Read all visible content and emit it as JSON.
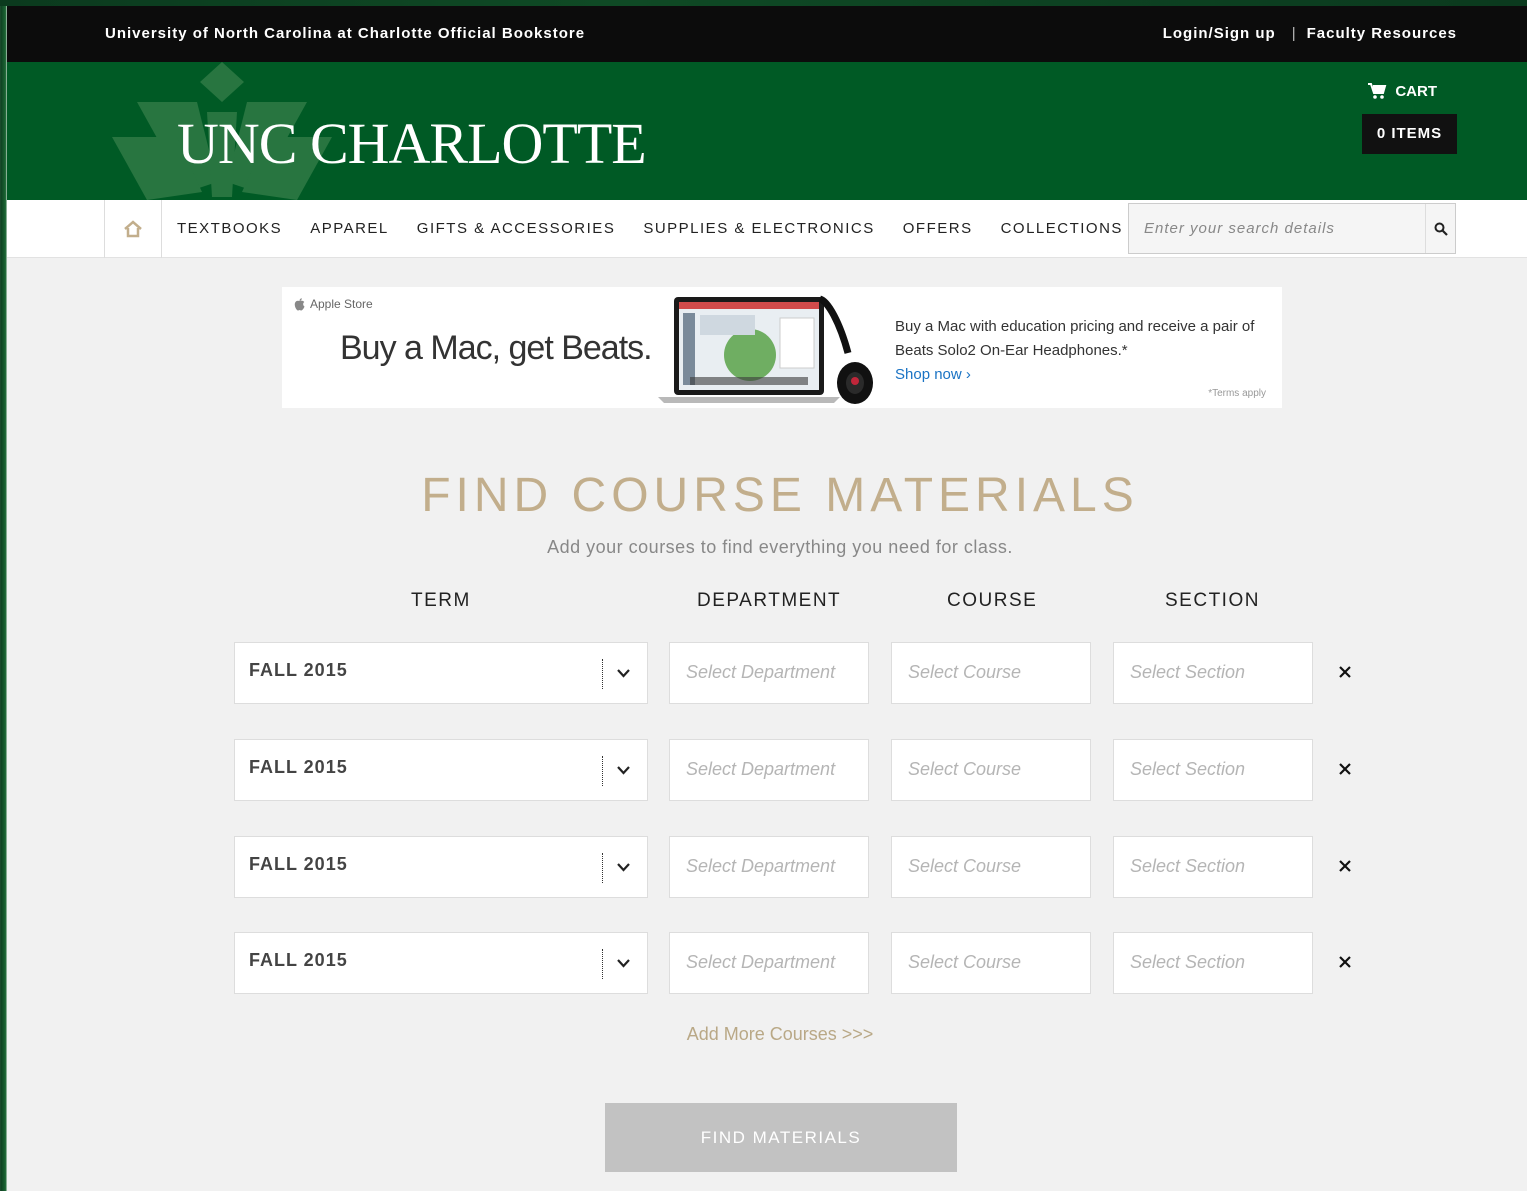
{
  "utility": {
    "store_name": "University of North Carolina at Charlotte Official Bookstore",
    "login": "Login/Sign up",
    "separator": "|",
    "faculty": "Faculty Resources"
  },
  "header": {
    "logo": "UNC CHARLOTTE",
    "cart_label": "CART",
    "items_label": "0 ITEMS"
  },
  "nav": {
    "items": [
      "TEXTBOOKS",
      "APPAREL",
      "GIFTS & ACCESSORIES",
      "SUPPLIES & ELECTRONICS",
      "OFFERS",
      "COLLECTIONS"
    ],
    "search_placeholder": "Enter your search details"
  },
  "banner": {
    "store_label": "Apple Store",
    "headline": "Buy a Mac, get Beats.",
    "description": "Buy a Mac with education pricing and receive a pair of Beats Solo2 On-Ear Headphones.*",
    "shop_link": "Shop now ›",
    "terms": "*Terms apply"
  },
  "finder": {
    "title": "FIND COURSE MATERIALS",
    "subtitle": "Add your courses to find everything you need for class.",
    "columns": {
      "term": "TERM",
      "department": "DEPARTMENT",
      "course": "COURSE",
      "section": "SECTION"
    },
    "rows": [
      {
        "term": "FALL 2015",
        "department": "Select Department",
        "course": "Select Course",
        "section": "Select Section"
      },
      {
        "term": "FALL 2015",
        "department": "Select Department",
        "course": "Select Course",
        "section": "Select Section"
      },
      {
        "term": "FALL 2015",
        "department": "Select Department",
        "course": "Select Course",
        "section": "Select Section"
      },
      {
        "term": "FALL 2015",
        "department": "Select Department",
        "course": "Select Course",
        "section": "Select Section"
      }
    ],
    "add_more": "Add More Courses >>>",
    "find_button": "FIND MATERIALS"
  },
  "colors": {
    "brand_green": "#005a25",
    "gold": "#c2ae8c",
    "utility_bar": "#0c0c0c"
  }
}
